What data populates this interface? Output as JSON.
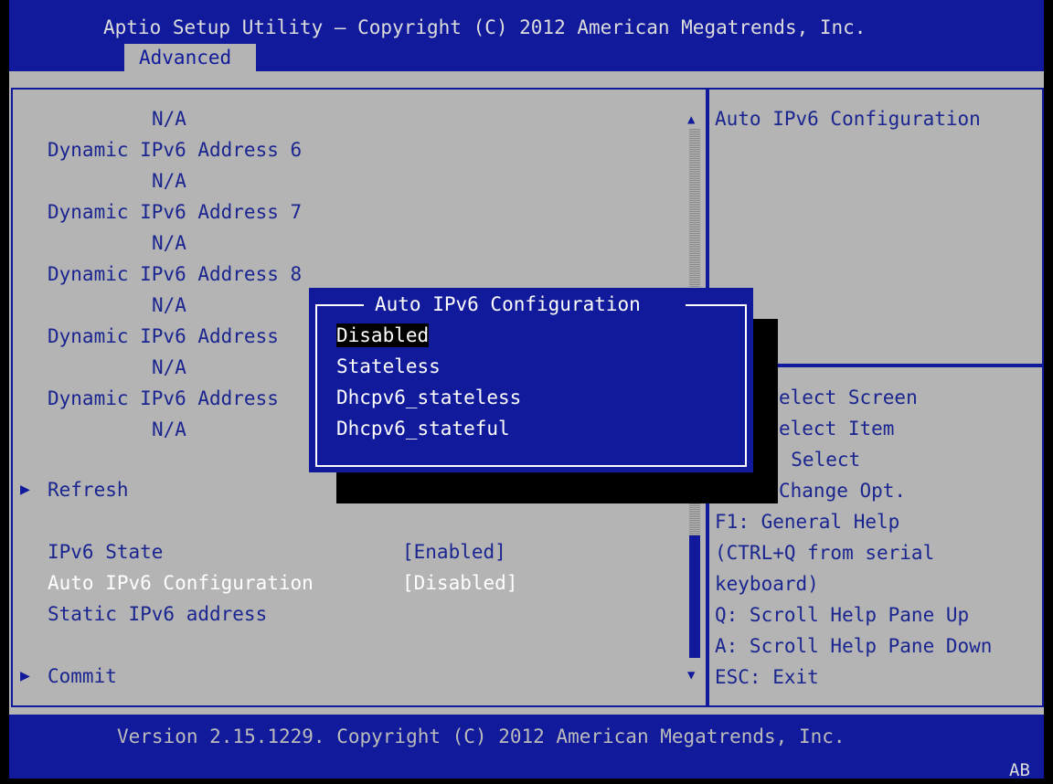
{
  "header": {
    "title": "Aptio Setup Utility – Copyright (C) 2012 American Megatrends, Inc.",
    "active_tab": "Advanced"
  },
  "main": {
    "lines": [
      {
        "label": "N/A",
        "type": "value"
      },
      {
        "label": "Dynamic IPv6 Address 6",
        "type": "label"
      },
      {
        "label": "N/A",
        "type": "value"
      },
      {
        "label": "Dynamic IPv6 Address 7",
        "type": "label"
      },
      {
        "label": "N/A",
        "type": "value"
      },
      {
        "label": "Dynamic IPv6 Address 8",
        "type": "label"
      },
      {
        "label": "N/A",
        "type": "value"
      },
      {
        "label": "Dynamic IPv6 Address",
        "type": "label"
      },
      {
        "label": "N/A",
        "type": "value"
      },
      {
        "label": "Dynamic IPv6 Address",
        "type": "label"
      },
      {
        "label": "N/A",
        "type": "value"
      }
    ],
    "refresh": "Refresh",
    "settings": [
      {
        "label": "IPv6 State",
        "value": "[Enabled]"
      },
      {
        "label": "Auto IPv6 Configuration",
        "value": "[Disabled]"
      },
      {
        "label": "Static IPv6 address",
        "value": ""
      }
    ],
    "commit": "Commit",
    "arrow": "▶",
    "scroll_up": "▲",
    "scroll_down": "▼"
  },
  "help": {
    "description": "Auto IPv6 Configuration",
    "keys": [
      "elect Screen",
      "elect Item",
      ": Select",
      "Change Opt.",
      "F1: General Help",
      "(CTRL+Q from serial",
      "keyboard)",
      "Q: Scroll Help Pane Up",
      "A: Scroll Help Pane Down",
      "ESC: Exit"
    ]
  },
  "popup": {
    "title": "Auto IPv6 Configuration",
    "options": [
      "Disabled",
      "Stateless",
      "Dhcpv6_stateless",
      "Dhcpv6_stateful"
    ],
    "selected": "Disabled"
  },
  "footer": {
    "version": "Version 2.15.1229. Copyright (C) 2012 American Megatrends, Inc.",
    "badge": "AB"
  },
  "colors": {
    "blue": "#101a9a",
    "gray": "#b4b4b4",
    "label_blue": "#1a2590",
    "value_blue": "#1a2590"
  }
}
